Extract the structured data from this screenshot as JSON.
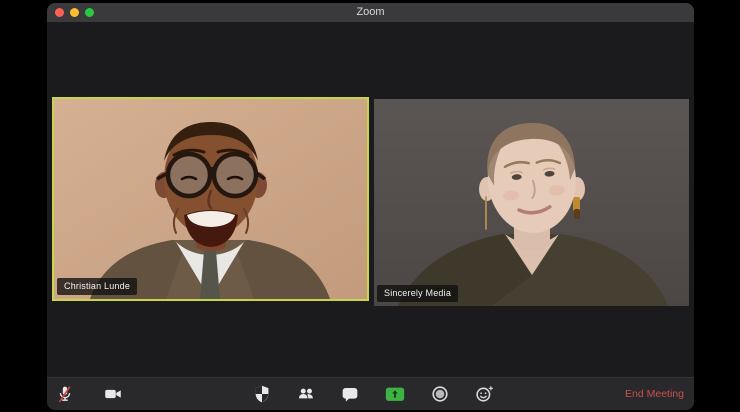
{
  "window": {
    "title": "Zoom",
    "traffic_lights": [
      "close",
      "minimize",
      "fullscreen"
    ]
  },
  "participants": [
    {
      "name": "Christian Lunde",
      "active_speaker": true
    },
    {
      "name": "Sincerely Media",
      "active_speaker": false
    }
  ],
  "toolbar": {
    "buttons": [
      {
        "id": "mute",
        "icon": "microphone-muted-icon"
      },
      {
        "id": "video",
        "icon": "video-camera-icon"
      },
      {
        "id": "security",
        "icon": "shield-icon"
      },
      {
        "id": "participants",
        "icon": "participants-icon"
      },
      {
        "id": "chat",
        "icon": "chat-bubble-icon"
      },
      {
        "id": "share-screen",
        "icon": "share-screen-icon"
      },
      {
        "id": "record",
        "icon": "record-circle-icon"
      },
      {
        "id": "reactions",
        "icon": "smiley-reactions-icon"
      }
    ],
    "end_meeting_label": "End Meeting"
  },
  "colors": {
    "active_speaker_border": "#c8d44a",
    "share_screen_green": "#3cb343",
    "end_meeting_red": "#c94f4f",
    "titlebar_bg": "#3a3a3c",
    "toolbar_bg": "#29292b",
    "content_bg": "#1b1b1d"
  }
}
